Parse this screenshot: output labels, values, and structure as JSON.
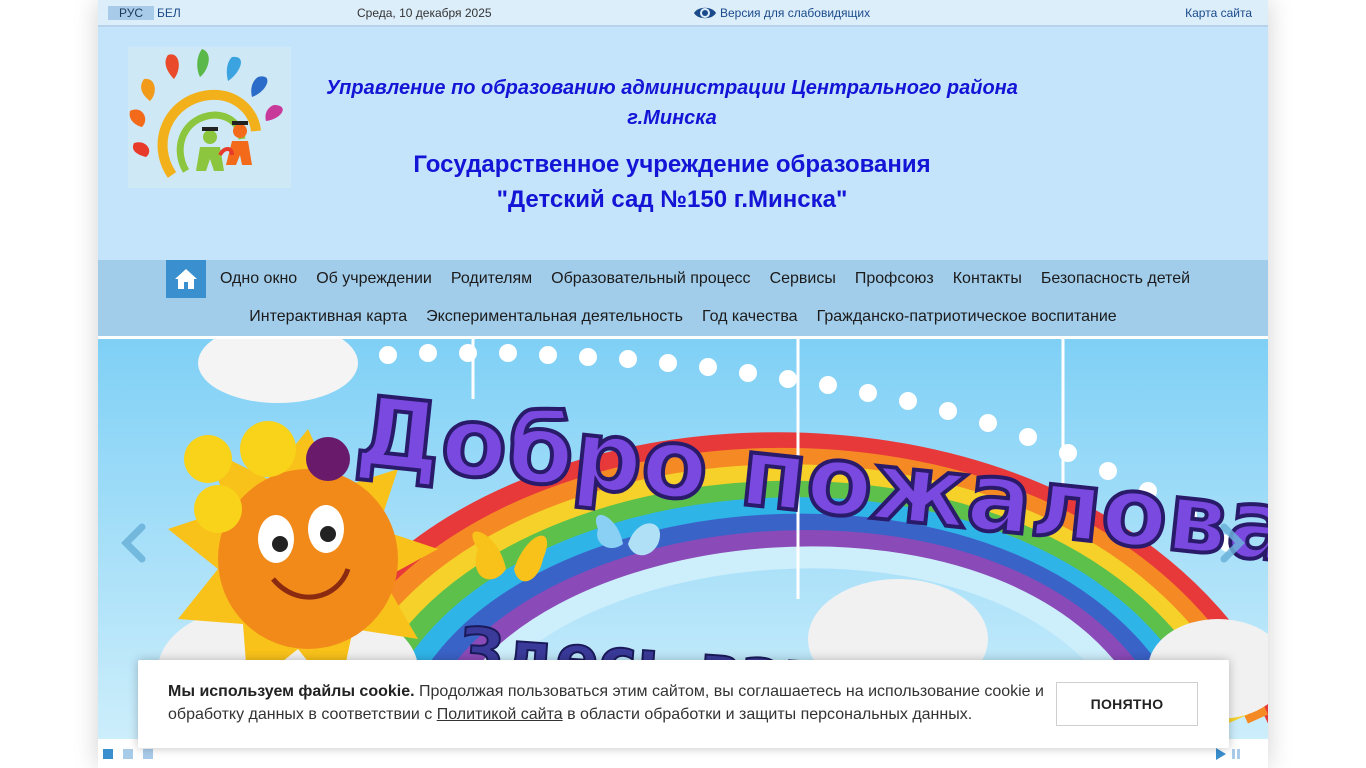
{
  "topbar": {
    "lang_active": "РУС",
    "lang_other": "БЕЛ",
    "date": "Среда, 10 декабря 2025",
    "vision_label": "Версия для слабовидящих",
    "sitemap_label": "Карта сайта"
  },
  "header": {
    "line1": "Управление по образованию администрации Центрального района",
    "line1b": "г.Минска",
    "line2": "Государственное учреждение образования",
    "line2b": "\"Детский сад №150 г.Минска\""
  },
  "nav": {
    "row1": [
      "Одно окно",
      "Об учреждении",
      "Родителям",
      "Образовательный процесс",
      "Сервисы",
      "Профсоюз",
      "Контакты",
      "Безопасность детей"
    ],
    "row2": [
      "Интерактивная карта",
      "Экспериментальная деятельность",
      "Год качества",
      "Гражданско-патриотическое воспитание"
    ]
  },
  "banner": {
    "line1": "Добро пожаловать!",
    "line2": "Здесь вам рады!"
  },
  "slider": {
    "slides_count": 3,
    "active_slide": 1
  },
  "cookie": {
    "bold": "Мы используем файлы cookie.",
    "text1": " Продолжая пользоваться этим сайтом, вы соглашаетесь на использование cookie и обработку данных в соответствии с ",
    "link": "Политикой сайта",
    "text2": " в области обработки и защиты персональных данных.",
    "button": "ПОНЯТНО"
  },
  "colors": {
    "header_bg": "#c4e4fb",
    "nav_bg": "#a2cdea",
    "accent": "#3a8fcf",
    "title_blue": "#1414d6"
  },
  "icons": [
    "eye-icon",
    "home-icon",
    "chevron-left-icon",
    "chevron-right-icon",
    "play-icon",
    "pause-icon"
  ]
}
